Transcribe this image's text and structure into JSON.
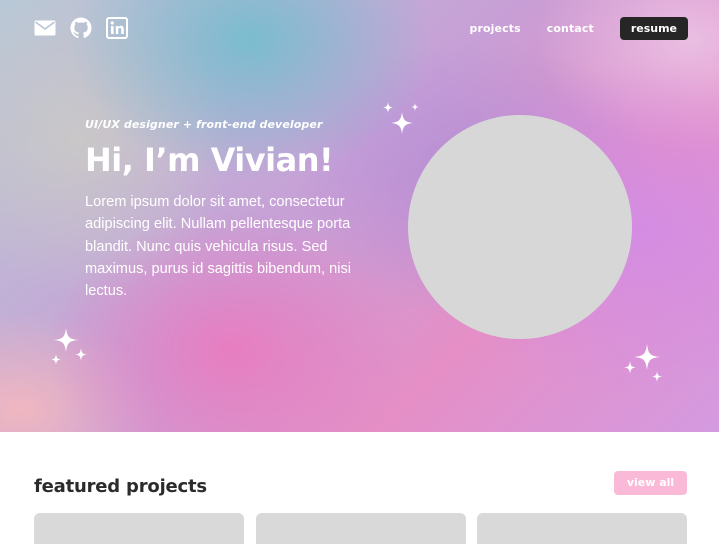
{
  "header": {
    "social_icons": [
      "email-icon",
      "github-icon",
      "linkedin-icon"
    ],
    "nav": {
      "projects": "projects",
      "contact": "contact",
      "resume": "resume"
    }
  },
  "hero": {
    "tagline": "UI/UX designer + front-end developer",
    "headline": "Hi, I’m Vivian!",
    "intro": "Lorem ipsum dolor sit amet, consectetur adipiscing elit. Nullam pellentesque porta blandit. Nunc quis vehicula risus. Sed maximus, purus id sagittis bibendum, nisi lectus.",
    "decorations": [
      "sparkle-icon",
      "sparkle-icon",
      "sparkle-icon"
    ]
  },
  "featured": {
    "title": "featured projects",
    "view_all": "view all",
    "cards": 3
  },
  "colors": {
    "text_on_hero": "#ffffff",
    "resume_button": "#262626",
    "view_all_button": "#f9b9d7",
    "placeholder": "#d9d9d9",
    "heading": "#2b2b2b"
  }
}
